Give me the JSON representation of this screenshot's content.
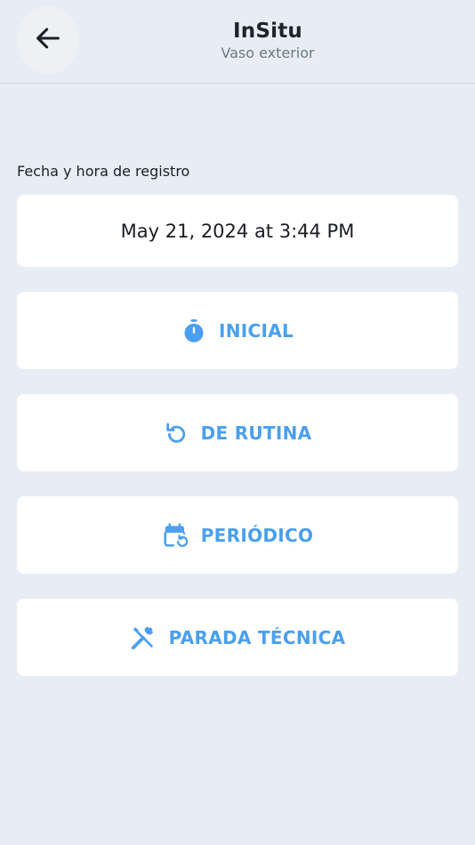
{
  "header": {
    "title": "InSitu",
    "subtitle": "Vaso exterior",
    "back_icon": "arrow-left-icon"
  },
  "form": {
    "date_label": "Fecha y hora de registro",
    "date_value": "May 21, 2024 at 3:44 PM"
  },
  "options": [
    {
      "label": "INICIAL",
      "icon": "stopwatch-icon"
    },
    {
      "label": "DE RUTINA",
      "icon": "refresh-icon"
    },
    {
      "label": "PERIÓDICO",
      "icon": "calendar-repeat-icon"
    },
    {
      "label": "PARADA TÉCNICA",
      "icon": "tools-icon"
    }
  ],
  "colors": {
    "background": "#e6edf5",
    "accent": "#4a9fee",
    "card": "#ffffff"
  }
}
